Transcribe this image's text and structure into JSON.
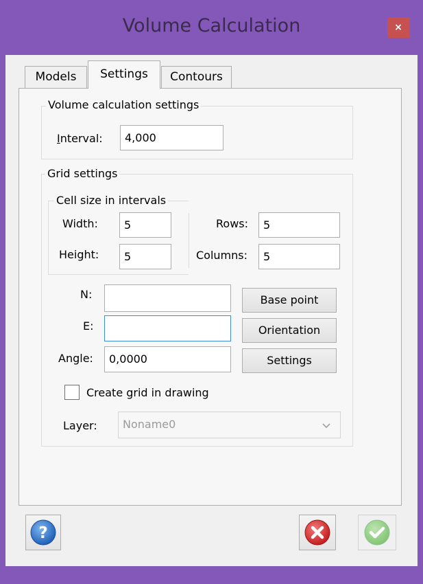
{
  "window": {
    "title": "Volume Calculation",
    "close_glyph": "×"
  },
  "tabs": [
    {
      "label": "Models",
      "selected": false
    },
    {
      "label": "Settings",
      "selected": true
    },
    {
      "label": "Contours",
      "selected": false
    }
  ],
  "volume_settings": {
    "legend": "Volume calculation settings",
    "interval_label_mnemonic": "I",
    "interval_label_rest": "nterval:",
    "interval_value": "4,000"
  },
  "grid_settings": {
    "legend": "Grid settings",
    "cell_size": {
      "legend": "Cell size in intervals",
      "width_label": "Width:",
      "width_value": "5",
      "height_label": "Height:",
      "height_value": "5"
    },
    "rows_label": "Rows:",
    "rows_value": "5",
    "columns_label": "Columns:",
    "columns_value": "5",
    "n_label": "N:",
    "n_value": "",
    "e_label": "E:",
    "e_value": "",
    "angle_label": "Angle:",
    "angle_value": "0,0000",
    "base_point_button": "Base point",
    "orientation_button": "Orientation",
    "settings_button": "Settings",
    "create_grid_label": "Create grid in drawing",
    "create_grid_checked": false,
    "layer_label": "Layer:",
    "layer_value": "Noname0"
  },
  "footer": {
    "help_icon": "question-mark-icon",
    "cancel_icon": "red-x-icon",
    "ok_icon": "green-check-icon"
  },
  "colors": {
    "frame": "#8458b9",
    "close_button": "#c75050",
    "focus_border": "#3c8ad9",
    "help_blue": "#2d73c8",
    "cancel_red": "#d83b3b",
    "ok_green": "#5cb85c"
  }
}
